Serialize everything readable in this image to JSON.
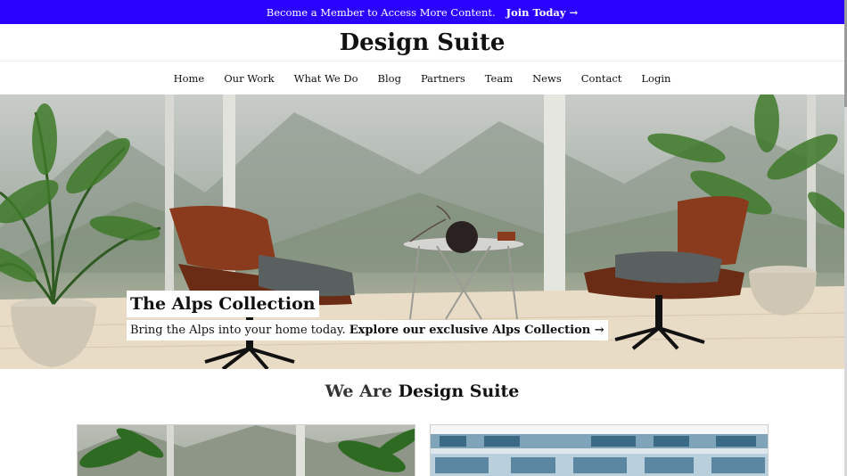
{
  "promo": {
    "message": "Become a Member to Access More Content.",
    "join_label": "Join Today →"
  },
  "brand": {
    "title": "Design Suite"
  },
  "nav": {
    "items": [
      "Home",
      "Our Work",
      "What We Do",
      "Blog",
      "Partners",
      "Team",
      "News",
      "Contact",
      "Login"
    ]
  },
  "hero": {
    "title": "The Alps Collection",
    "subtitle": "Bring the Alps into your home today.",
    "cta_label": "Explore our exclusive Alps Collection →"
  },
  "about": {
    "heading_prefix": "We Are",
    "heading_brand": "Design Suite"
  },
  "colors": {
    "promo_bg": "#2a00ff",
    "text": "#111111"
  }
}
